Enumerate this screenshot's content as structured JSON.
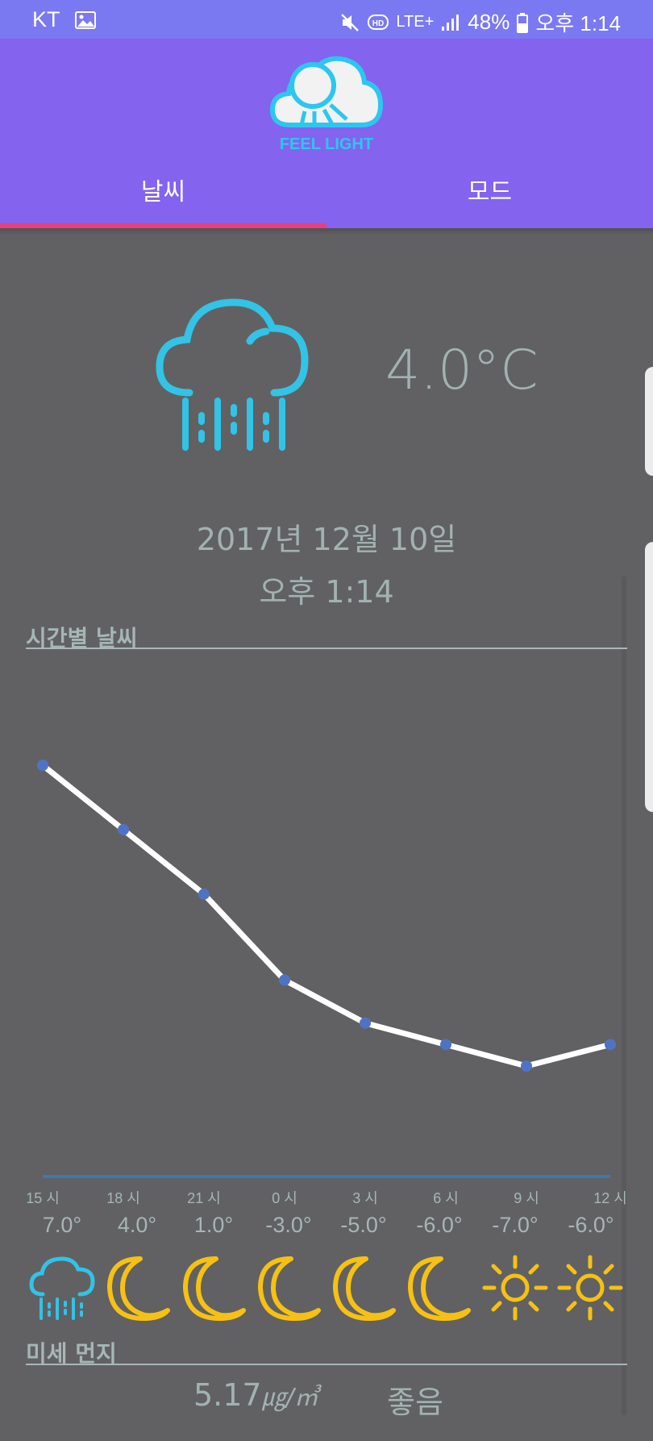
{
  "status_bar": {
    "carrier": "KT",
    "network": "LTE+",
    "battery": "48%",
    "time": "오후 1:14",
    "icons": [
      "gallery-icon",
      "mute-icon",
      "hd-icon",
      "lte-icon",
      "signal-icon",
      "battery-icon"
    ]
  },
  "header": {
    "logo_text": "FEEL LIGHT",
    "tabs": [
      {
        "label": "날씨",
        "selected": true
      },
      {
        "label": "모드",
        "selected": false
      }
    ],
    "colors": {
      "bar": "#8463ee",
      "status": "#7b79f2",
      "indicator": "#ea3f7a",
      "logo": "#2cc7ee"
    }
  },
  "current": {
    "icon": "rain-icon",
    "temperature": "4.0°C",
    "date": "2017년 12월 10일",
    "time": "오후 1:14"
  },
  "hourly": {
    "title": "시간별 날씨",
    "hours": [
      "15 시",
      "18 시",
      "21 시",
      "0 시",
      "3 시",
      "6 시",
      "9 시",
      "12 시"
    ],
    "temps": [
      "7.0°",
      "4.0°",
      "1.0°",
      "-3.0°",
      "-5.0°",
      "-6.0°",
      "-7.0°",
      "-6.0°"
    ],
    "icons": [
      "rain-icon",
      "moon-icon",
      "moon-icon",
      "moon-icon",
      "moon-icon",
      "moon-icon",
      "sun-icon",
      "sun-icon"
    ]
  },
  "chart_data": {
    "type": "line",
    "categories": [
      "15 시",
      "18 시",
      "21 시",
      "0 시",
      "3 시",
      "6 시",
      "9 시",
      "12 시"
    ],
    "values": [
      7.0,
      4.0,
      1.0,
      -3.0,
      -5.0,
      -6.0,
      -7.0,
      -6.0
    ],
    "title": "시간별 날씨",
    "xlabel": "",
    "ylabel": "",
    "ylim": [
      -10,
      10
    ],
    "grid": false,
    "line_color": "#ffffff",
    "point_color": "#4f73c4"
  },
  "dust": {
    "title": "미세 먼지",
    "value": "5.17",
    "unit": "㎍/㎥",
    "status": "좋음"
  }
}
